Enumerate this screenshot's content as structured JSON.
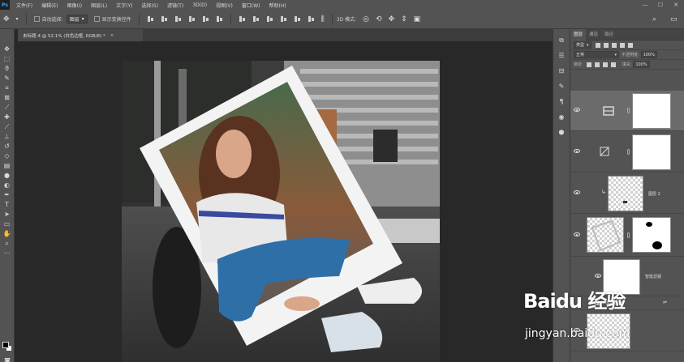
{
  "app": {
    "logo": "Ps"
  },
  "menubar": {
    "items": [
      "文件(F)",
      "编辑(E)",
      "图像(I)",
      "图层(L)",
      "文字(Y)",
      "选择(S)",
      "滤镜(T)",
      "3D(D)",
      "视图(V)",
      "窗口(W)",
      "帮助(H)"
    ]
  },
  "window_controls": {
    "minimize": "—",
    "restore": "☐",
    "close": "✕"
  },
  "options_bar": {
    "auto_select_label": "自动选择:",
    "auto_select_value": "图层",
    "show_transform_label": "显示变换控件",
    "mode_3d_label": "3D 模式:"
  },
  "document": {
    "tab_title": "未标题-4 @ 52.1% (白色边框, RGB/8) *",
    "close": "×"
  },
  "layers_panel": {
    "tabs": [
      "图层",
      "通道",
      "路径"
    ],
    "filter_kind": "类型",
    "blend_mode": "正常",
    "opacity_label": "不透明度:",
    "opacity_value": "100%",
    "lock_label": "锁定:",
    "fill_label": "填充:",
    "fill_value": "100%",
    "layers": [
      {
        "name": ""
      },
      {
        "name": ""
      },
      {
        "name": "图层 2"
      },
      {
        "name": ""
      },
      {
        "name": "智能滤镜"
      },
      {
        "name": "高斯模糊"
      }
    ]
  },
  "watermark": {
    "logo": "Baidu 经验",
    "url": "jingyan.baidu.com"
  },
  "colors": {
    "chrome": "#535353",
    "canvas_bg": "#282828",
    "ps_blue": "#31a8ff"
  }
}
